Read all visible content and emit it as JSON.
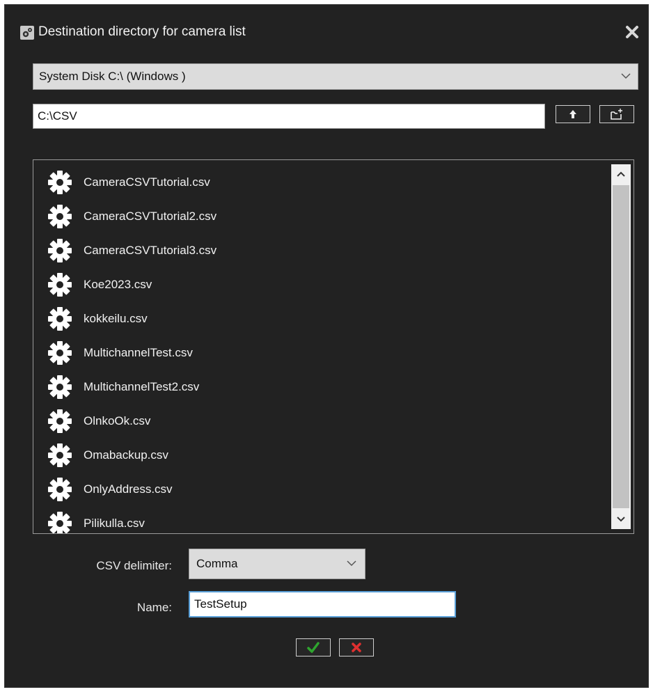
{
  "dialog": {
    "title": "Destination directory for camera list",
    "drive": {
      "selected": "System Disk C:\\ (Windows )"
    },
    "path": {
      "value": "C:\\CSV"
    },
    "files": [
      "CameraCSVTutorial.csv",
      "CameraCSVTutorial2.csv",
      "CameraCSVTutorial3.csv",
      "Koe2023.csv",
      "kokkeilu.csv",
      "MultichannelTest.csv",
      "MultichannelTest2.csv",
      "OlnkoOk.csv",
      "Omabackup.csv",
      "OnlyAddress.csv",
      "Pilikulla.csv"
    ],
    "csv_delimiter": {
      "label": "CSV delimiter:",
      "selected": "Comma"
    },
    "name": {
      "label": "Name:",
      "value": "TestSetup"
    }
  },
  "icons": {
    "title": "settings-gear-icon",
    "close": "close-icon",
    "up": "arrow-up-icon",
    "new_folder": "new-folder-icon",
    "file": "gear-icon",
    "ok": "checkmark-icon",
    "cancel": "x-icon"
  },
  "colors": {
    "dialog_bg": "#222222",
    "ok_green": "#2fa52f",
    "cancel_red": "#e03030",
    "input_focus": "#5aa0d8"
  }
}
